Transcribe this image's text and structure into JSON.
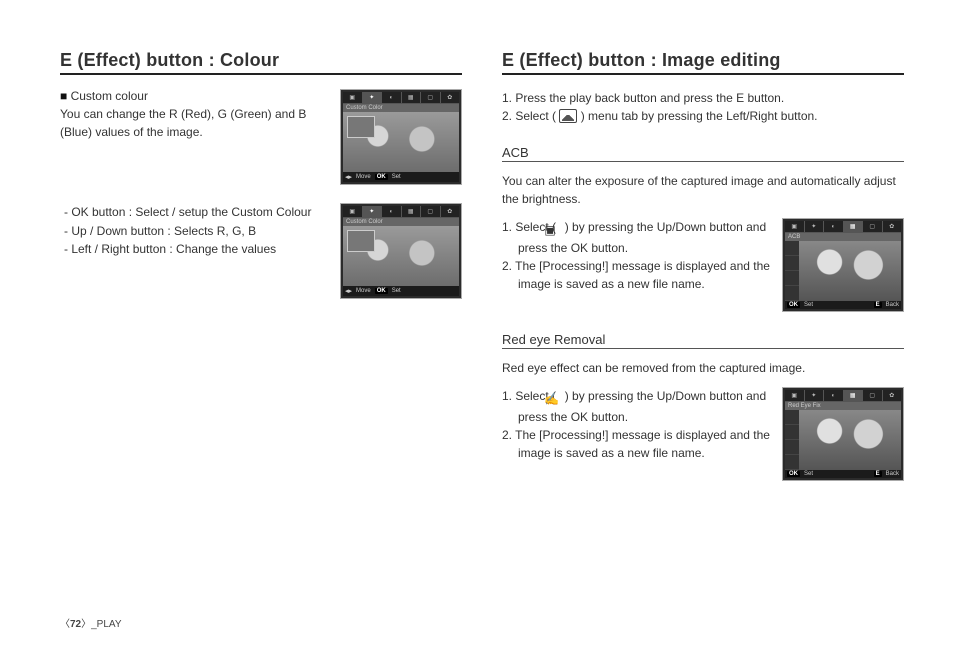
{
  "left": {
    "heading": "E (Effect) button : Colour",
    "sub": "Custom colour",
    "desc": "You can change the R (Red), G (Green) and B (Blue) values of the image.",
    "controls": [
      "- OK button : Select / setup the Custom Colour",
      "- Up / Down button  : Selects R, G, B",
      "- Left / Right button : Change the values"
    ],
    "thumb": {
      "title": "Custom Color",
      "footer_move": "Move",
      "footer_ok": "OK",
      "footer_set": "Set"
    }
  },
  "right": {
    "heading": "E (Effect) button : Image editing",
    "steps_intro": [
      "1. Press the play back button and press the E button.",
      "2. Select (       ) menu tab by pressing the Left/Right button."
    ],
    "acb": {
      "title": "ACB",
      "desc": "You can alter the exposure of the captured image and automatically adjust the brightness.",
      "steps": [
        "1. Select (        ) by pressing the Up/Down button and press the OK button.",
        "2. The [Processing!] message is displayed and the image is saved as a new file name."
      ],
      "thumb": {
        "title": "ACB",
        "footer_ok": "OK",
        "footer_set": "Set",
        "footer_e": "E",
        "footer_back": "Back"
      }
    },
    "redeye": {
      "title": "Red eye Removal",
      "desc": "Red eye effect can be removed from the captured image.",
      "steps": [
        "1. Select (       ) by pressing the Up/Down button and press the OK button.",
        "2. The [Processing!] message is displayed and the image is saved as a new file name."
      ],
      "thumb": {
        "title": "Red Eye Fix",
        "footer_ok": "OK",
        "footer_set": "Set",
        "footer_e": "E",
        "footer_back": "Back"
      }
    }
  },
  "footer": {
    "page": "72",
    "section": "_PLAY"
  }
}
